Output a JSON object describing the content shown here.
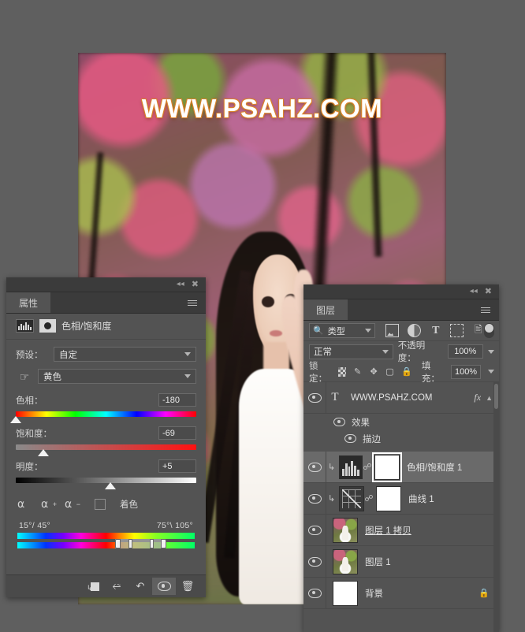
{
  "app": {
    "workspace_bg": "#5f5f5f"
  },
  "document": {
    "watermark_text": "WWW.PSAHZ.COM"
  },
  "properties_panel": {
    "tab_label": "属性",
    "title": "色相/饱和度",
    "adjustment_icon": "hue-saturation-icon",
    "mask_icon": "layer-mask-icon",
    "preset": {
      "label": "预设：",
      "value": "自定"
    },
    "channel": {
      "icon": "on-image-adjust-hand-icon",
      "value": "黄色"
    },
    "hue": {
      "label": "色相：",
      "value": "-180",
      "thumb_pct": 0
    },
    "saturation": {
      "label": "饱和度：",
      "value": "-69",
      "thumb_pct": 15.5
    },
    "lightness": {
      "label": "明度：",
      "value": "+5",
      "thumb_pct": 52.5
    },
    "eyedroppers": [
      "eyedropper-icon",
      "eyedropper-add-icon",
      "eyedropper-subtract-icon"
    ],
    "colorize": {
      "label": "着色",
      "checked": false
    },
    "range_left": "15°/ 45°",
    "range_right": "75°\\ 105°",
    "color_range": {
      "outer_left_pct": 55.0,
      "inner_left_pct": 62.5,
      "inner_right_pct": 74.5,
      "outer_right_pct": 82.0
    },
    "footer_buttons": [
      {
        "name": "clip-to-layer-button",
        "icon": "clip-to-layer-icon",
        "active": false
      },
      {
        "name": "toggle-previous-state-button",
        "icon": "previous-state-icon",
        "active": false
      },
      {
        "name": "reset-button",
        "icon": "reset-icon",
        "active": false
      },
      {
        "name": "toggle-visibility-button",
        "icon": "eye-icon",
        "active": true
      },
      {
        "name": "delete-button",
        "icon": "trash-icon",
        "active": false
      }
    ]
  },
  "layers_panel": {
    "tab_label": "图层",
    "filter": {
      "icon": "search-icon",
      "value": "类型"
    },
    "filter_icons": [
      "pixel-layer-filter-icon",
      "adjustment-layer-filter-icon",
      "type-layer-filter-icon",
      "shape-layer-filter-icon",
      "smart-object-filter-icon"
    ],
    "filter_toggle": "filter-enable-toggle",
    "blend_mode": "正常",
    "opacity": {
      "label": "不透明度：",
      "value": "100%"
    },
    "lock": {
      "label": "锁定：",
      "icons": [
        "lock-transparency-icon",
        "lock-pixels-icon",
        "lock-position-icon",
        "lock-artboard-icon",
        "lock-all-icon"
      ]
    },
    "fill": {
      "label": "填充：",
      "value": "100%"
    },
    "layers": [
      {
        "name": "WWW.PSAHZ.COM",
        "kind": "type",
        "visible": true,
        "selected": false,
        "fx": "fx",
        "effects_group": {
          "label": "效果",
          "visible": true
        },
        "effects": [
          {
            "label": "描边",
            "visible": true
          }
        ]
      },
      {
        "name": "色相/饱和度 1",
        "kind": "adjustment-hue-saturation",
        "visible": true,
        "selected": true,
        "clipped": true,
        "linked": true,
        "mask_selected": true
      },
      {
        "name": "曲线 1",
        "kind": "adjustment-curves",
        "visible": true,
        "selected": false,
        "clipped": true,
        "linked": true,
        "mask_selected": false
      },
      {
        "name": "图层 1 拷贝",
        "kind": "pixel",
        "visible": true,
        "selected": false,
        "underlined": true
      },
      {
        "name": "图层 1",
        "kind": "pixel",
        "visible": true,
        "selected": false
      },
      {
        "name": "背景",
        "kind": "background",
        "visible": true,
        "selected": false,
        "locked": true
      }
    ]
  }
}
